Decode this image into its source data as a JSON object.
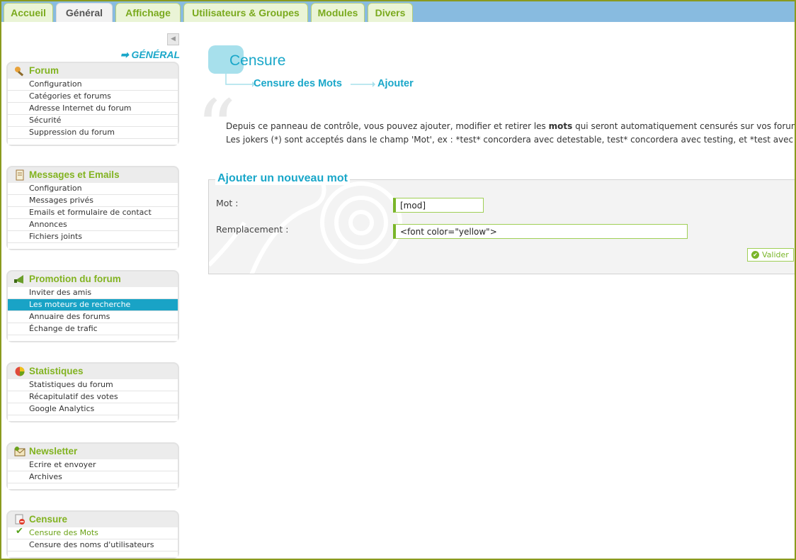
{
  "tabs": [
    "Accueil",
    "Général",
    "Affichage",
    "Utilisateurs & Groupes",
    "Modules",
    "Divers"
  ],
  "sidebar": {
    "title": "GÉNÉRAL",
    "boxes": [
      {
        "title": "Forum",
        "icon": "wrench-icon",
        "items": [
          "Configuration",
          "Catégories et forums",
          "Adresse Internet du forum",
          "Sécurité",
          "Suppression du forum"
        ]
      },
      {
        "title": "Messages et Emails",
        "icon": "document-icon",
        "items": [
          "Configuration",
          "Messages privés",
          "Emails et formulaire de contact",
          "Annonces",
          "Fichiers joints"
        ]
      },
      {
        "title": "Promotion du forum",
        "icon": "megaphone-icon",
        "items": [
          "Inviter des amis",
          "Les moteurs de recherche",
          "Annuaire des forums",
          "Échange de trafic"
        ],
        "selected": 1
      },
      {
        "title": "Statistiques",
        "icon": "pie-chart-icon",
        "items": [
          "Statistiques du forum",
          "Récapitulatif des votes",
          "Google Analytics"
        ]
      },
      {
        "title": "Newsletter",
        "icon": "mail-icon",
        "items": [
          "Ecrire et envoyer",
          "Archives"
        ]
      },
      {
        "title": "Censure",
        "icon": "censure-icon",
        "items": [
          "Censure des Mots",
          "Censure des noms d'utilisateurs"
        ],
        "current": 0
      }
    ]
  },
  "main": {
    "title": "Censure",
    "breadcrumb": [
      "Censure des Mots",
      "Ajouter"
    ],
    "desc_line1_a": "Depuis ce panneau de contrôle, vous pouvez ajouter, modifier et retirer les ",
    "desc_line1_bold": "mots",
    "desc_line1_b": " qui seront automatiquement censurés sur vos forums.",
    "desc_line2": "Les jokers (*) sont acceptés dans le champ 'Mot', ex : *test* concordera avec detestable, test* concordera avec testing, et *test avec det",
    "form": {
      "legend": "Ajouter un nouveau mot",
      "mot_label": "Mot :",
      "mot_value": "[mod]",
      "repl_label": "Remplacement :",
      "repl_value": "<font color=\"yellow\">",
      "submit": "Valider"
    }
  },
  "colors": {
    "accent_green": "#82b321",
    "accent_blue": "#1aa7c9",
    "selected_bg": "#19a3c6"
  }
}
